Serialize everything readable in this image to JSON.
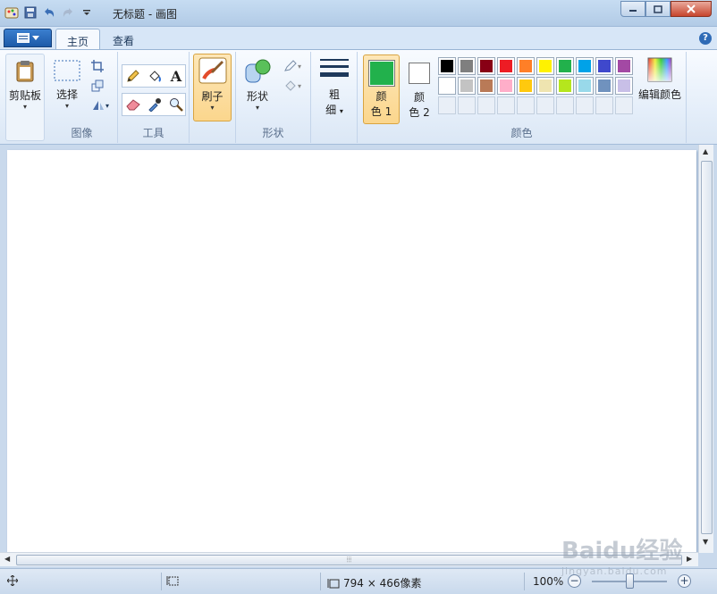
{
  "window": {
    "title": "无标题 - 画图",
    "min_icon": "minimize-icon",
    "max_icon": "maximize-icon",
    "close_icon": "close-icon"
  },
  "tabs": [
    "主页",
    "查看"
  ],
  "groups": {
    "clipboard": {
      "label": "剪贴板"
    },
    "image": {
      "label": "图像",
      "select_label": "选择"
    },
    "tools": {
      "label": "工具"
    },
    "brushes": {
      "label": "刷子"
    },
    "shapes": {
      "label": "形状",
      "shapes_label": "形状"
    },
    "size": {
      "line1": "粗",
      "line2": "细"
    },
    "colors": {
      "label": "颜色",
      "color1_line1": "颜",
      "color1_line2": "色 1",
      "color2_line1": "颜",
      "color2_line2": "色 2",
      "edit_colors": "编辑颜色",
      "color1": "#22b14c",
      "color2": "#ffffff",
      "palette_row1": [
        "#000000",
        "#7f7f7f",
        "#880015",
        "#ed1c24",
        "#ff7f27",
        "#fff200",
        "#22b14c",
        "#00a2e8",
        "#3f48cc",
        "#a349a4"
      ],
      "palette_row2": [
        "#ffffff",
        "#c3c3c3",
        "#b97a57",
        "#ffaec9",
        "#ffc90e",
        "#efe4b0",
        "#b5e61d",
        "#99d9ea",
        "#7092be",
        "#c8bfe7"
      ]
    }
  },
  "scroll": {
    "grip": "⦙⦙⦙"
  },
  "status": {
    "canvas_size": "794 × 466像素",
    "zoom": "100%",
    "zoom_minus": "−",
    "zoom_plus": "+"
  },
  "watermark": {
    "main": "Baidu经验",
    "sub": "jingyan.baidu.com"
  },
  "colors_theme": {
    "accent": "#2f6bb6",
    "ribbon_bg": "#e3edf9",
    "brush_active": "#fbd68d"
  }
}
